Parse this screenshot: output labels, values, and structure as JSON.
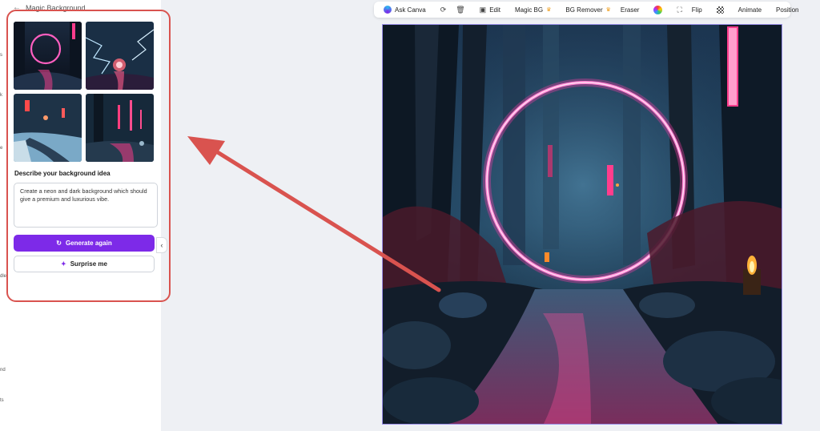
{
  "panel": {
    "title": "Magic Background",
    "prompt_label": "Describe your background idea",
    "prompt_value": "Create a neon and dark background which should give a premium and luxurious vibe.",
    "generate_label": "Generate again",
    "surprise_label": "Surprise me",
    "thumbnail_count": 4
  },
  "rail": {
    "fragments": [
      "s",
      "k",
      "e",
      "dle",
      "nd",
      "ts"
    ]
  },
  "toolbar": {
    "ask": "Ask Canva",
    "edit": "Edit",
    "magic_bg": "Magic BG",
    "bg_remover": "BG Remover",
    "eraser": "Eraser",
    "flip": "Flip",
    "animate": "Animate",
    "position": "Position"
  },
  "icons": [
    "back-arrow-icon",
    "refresh-icon",
    "sparkle-icon",
    "sync-icon",
    "trash-icon",
    "image-edit-icon",
    "crown-icon",
    "color-wheel-icon",
    "crop-icon",
    "transparency-icon",
    "chevron-left-icon"
  ],
  "colors": {
    "accent": "#7d2ae8",
    "highlight": "#d9534f",
    "neon": "#ff3da8"
  }
}
